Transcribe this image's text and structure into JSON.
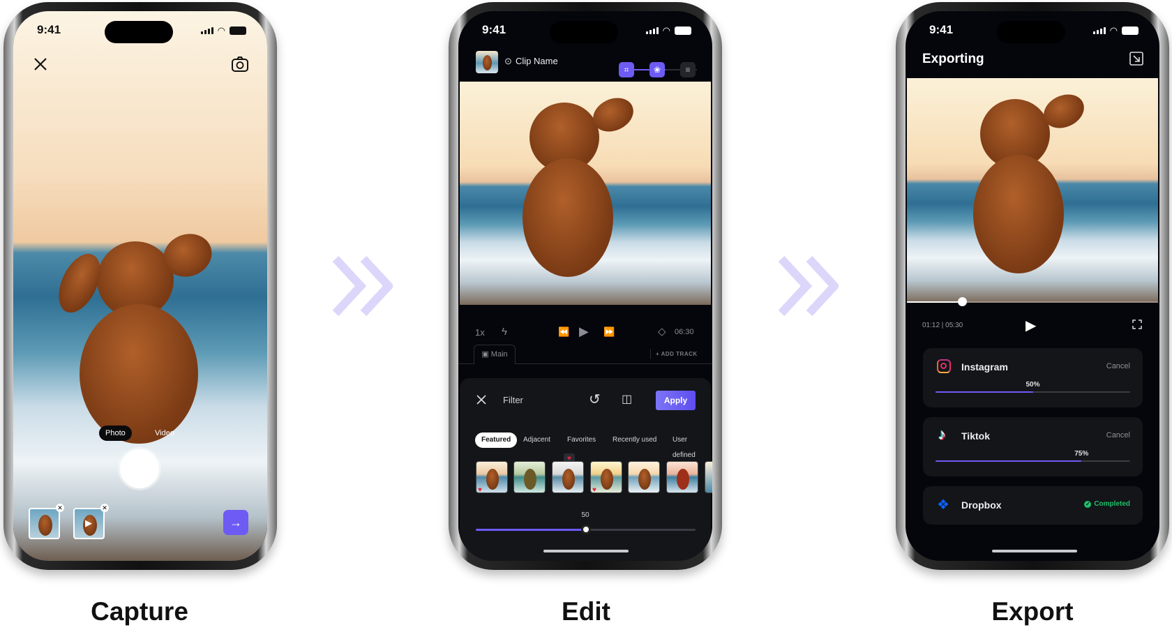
{
  "colors": {
    "accent": "#6d5bf4",
    "completed": "#1fbf6a",
    "background": "#05060c"
  },
  "status_time": "9:41",
  "capture": {
    "label": "Capture",
    "modes": [
      "Photo",
      "Video"
    ],
    "selected_mode": "Photo",
    "icons": {
      "close": "close-icon",
      "flip": "camera-flip-icon",
      "next": "arrow-right-icon"
    }
  },
  "edit": {
    "label": "Edit",
    "clip_name": "Clip Name",
    "speed": "1x",
    "duration": "06:30",
    "track_tab": "Main",
    "add_track": "+ ADD TRACK",
    "panel_title": "Filter",
    "apply": "Apply",
    "filter_tabs": [
      "Featured",
      "Adjacent",
      "Favorites",
      "Recently used",
      "User defined"
    ],
    "selected_filter_tab": "Featured",
    "intensity_value": "50",
    "intensity_percent": 50
  },
  "export": {
    "label": "Export",
    "title": "Exporting",
    "timecode": "01:12 | 05:30",
    "playback_fraction": 0.22,
    "destinations": [
      {
        "name": "Instagram",
        "action": "Cancel",
        "progress_label": "50%",
        "progress": 50
      },
      {
        "name": "Tiktok",
        "action": "Cancel",
        "progress_label": "75%",
        "progress": 75
      },
      {
        "name": "Dropbox",
        "status": "Completed"
      }
    ]
  }
}
